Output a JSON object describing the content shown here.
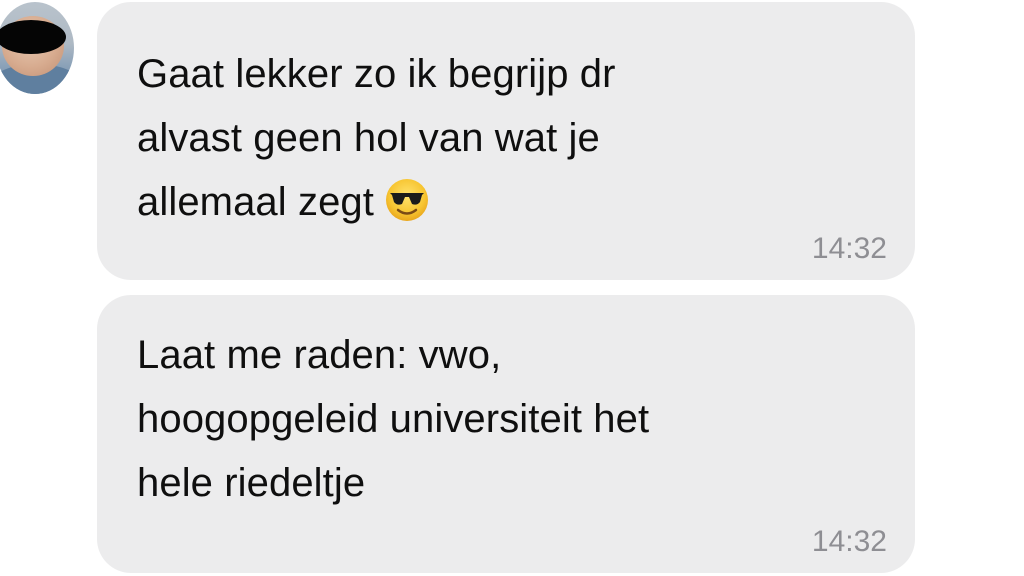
{
  "messages": [
    {
      "line1": "Gaat lekker zo ik begrijp dr",
      "line2": "alvast geen hol van wat je",
      "line3": "allemaal zegt",
      "emoji": "smiling-face-with-sunglasses",
      "time": "14:32"
    },
    {
      "line1": "Laat me raden: vwo,",
      "line2": "hoogopgeleid universiteit het",
      "line3": "hele riedeltje",
      "time": "14:32"
    }
  ]
}
